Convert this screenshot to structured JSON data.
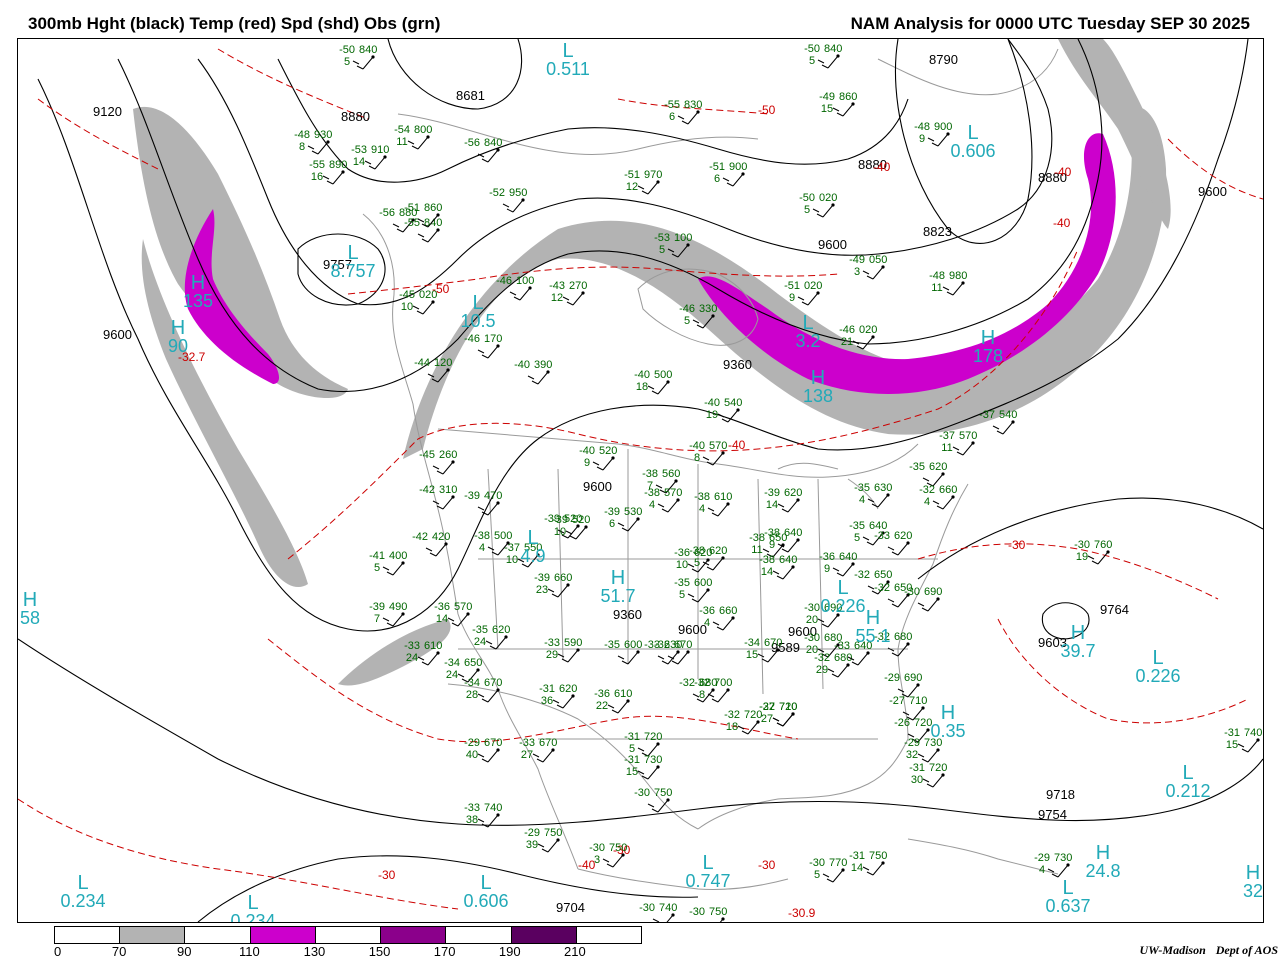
{
  "title_left": "300mb Hght (black) Temp (red) Spd (shd) Obs (grn)",
  "title_right": "NAM Analysis for 0000 UTC Tuesday  SEP 30 2025",
  "credit": {
    "org": "UW-Madison",
    "dept": "Dept of AOS"
  },
  "colors": {
    "gray_shade": "#b3b3b3",
    "magenta_shade": "#cc00cc",
    "height": "#000000",
    "temp": "#cc0000",
    "obs": "#006600",
    "centers": "#22aab8",
    "borders": "#9a9a9a"
  },
  "legend": {
    "labels": [
      "0",
      "70",
      "90",
      "110",
      "130",
      "150",
      "170",
      "190",
      "210"
    ],
    "segments": [
      "#ffffff",
      "#b3b3b3",
      "#ffffff",
      "#cc00cc",
      "#ffffff",
      "#8b008b",
      "#ffffff",
      "#5a0060",
      "#ffffff"
    ]
  },
  "height_labels": [
    "9120",
    "8880",
    "8681",
    "8790",
    "8880",
    "8823",
    "9600",
    "9600",
    "9360",
    "9600",
    "9360",
    "9600",
    "9589",
    "9764",
    "9603",
    "9718",
    "9754",
    "9704",
    "9757",
    "9600",
    "9600",
    "8880"
  ],
  "temp_labels": [
    "-50",
    "-50",
    "-40",
    "-40",
    "-40",
    "-40",
    "-40",
    "-30",
    "-30",
    "-30",
    "-30",
    "-32.7",
    "-30.9"
  ],
  "centers": [
    {
      "sym": "L",
      "val": "0.511"
    },
    {
      "sym": "L",
      "val": "0.606"
    },
    {
      "sym": "L",
      "val": "8.757"
    },
    {
      "sym": "H",
      "val": "135"
    },
    {
      "sym": "H",
      "val": "90"
    },
    {
      "sym": "L",
      "val": "10.5"
    },
    {
      "sym": "L",
      "val": "3.2"
    },
    {
      "sym": "H",
      "val": "138"
    },
    {
      "sym": "H",
      "val": "178"
    },
    {
      "sym": "H",
      "val": "51.7"
    },
    {
      "sym": "L",
      "val": "4.9"
    },
    {
      "sym": "L",
      "val": "0.226"
    },
    {
      "sym": "H",
      "val": "55.1"
    },
    {
      "sym": "L",
      "val": "0.226"
    },
    {
      "sym": "H",
      "val": "39.7"
    },
    {
      "sym": "H",
      "val": "0.35"
    },
    {
      "sym": "L",
      "val": "0.212"
    },
    {
      "sym": "H",
      "val": "24.8"
    },
    {
      "sym": "L",
      "val": "0.637"
    },
    {
      "sym": "L",
      "val": "0.234"
    },
    {
      "sym": "L",
      "val": "0.234"
    },
    {
      "sym": "L",
      "val": "0.606"
    },
    {
      "sym": "L",
      "val": "0.747"
    },
    {
      "sym": "H",
      "val": "32"
    },
    {
      "sym": "H",
      "val": "58"
    }
  ],
  "obs": [
    [
      "-50",
      "840",
      "5"
    ],
    [
      "-48",
      "930",
      "8"
    ],
    [
      "-54",
      "800",
      "11"
    ],
    [
      "-53",
      "910",
      "14"
    ],
    [
      "-55",
      "890",
      "16"
    ],
    [
      "-56",
      "880",
      ""
    ],
    [
      "-55",
      "840",
      ""
    ],
    [
      "-51",
      "860",
      ""
    ],
    [
      "-52",
      "950",
      ""
    ],
    [
      "-56",
      "840",
      ""
    ],
    [
      "-51",
      "970",
      "12"
    ],
    [
      "-55",
      "830",
      "6"
    ],
    [
      "-51",
      "900",
      "6"
    ],
    [
      "-50",
      "840",
      "5"
    ],
    [
      "-49",
      "860",
      "15"
    ],
    [
      "-48",
      "900",
      "9"
    ],
    [
      "-50",
      "020",
      "5"
    ],
    [
      "-49",
      "050",
      "3"
    ],
    [
      "-48",
      "980",
      "11"
    ],
    [
      "-51",
      "020",
      "9"
    ],
    [
      "-46",
      "020",
      "21"
    ],
    [
      "-53",
      "100",
      "5"
    ],
    [
      "-46",
      "330",
      "5"
    ],
    [
      "-43",
      "270",
      "12"
    ],
    [
      "-46",
      "100",
      ""
    ],
    [
      "-45",
      "020",
      "10"
    ],
    [
      "-46",
      "170",
      ""
    ],
    [
      "-44",
      "120",
      ""
    ],
    [
      "-40",
      "390",
      ""
    ],
    [
      "-40",
      "500",
      "18"
    ],
    [
      "-40",
      "540",
      "19"
    ],
    [
      "-40",
      "570",
      "8"
    ],
    [
      "-40",
      "520",
      "9"
    ],
    [
      "-38",
      "560",
      "7"
    ],
    [
      "-38",
      "570",
      "4"
    ],
    [
      "-38",
      "610",
      "4"
    ],
    [
      "-39",
      "620",
      "14"
    ],
    [
      "-38",
      "620",
      "5"
    ],
    [
      "-38",
      "640",
      "9"
    ],
    [
      "-37",
      "570",
      "11"
    ],
    [
      "-37",
      "540",
      ""
    ],
    [
      "-39",
      "520",
      ""
    ],
    [
      "-35",
      "620",
      ""
    ],
    [
      "-35",
      "630",
      "4"
    ],
    [
      "-32",
      "660",
      "4"
    ],
    [
      "-45",
      "260",
      ""
    ],
    [
      "-42",
      "310",
      ""
    ],
    [
      "-39",
      "470",
      ""
    ],
    [
      "-39",
      "530",
      "6"
    ],
    [
      "-39",
      "520",
      "10"
    ],
    [
      "-38",
      "500",
      "4"
    ],
    [
      "-37",
      "550",
      "10"
    ],
    [
      "-42",
      "420",
      ""
    ],
    [
      "-41",
      "400",
      "5"
    ],
    [
      "-39",
      "660",
      "23"
    ],
    [
      "-36",
      "620",
      "10"
    ],
    [
      "-38",
      "650",
      "11"
    ],
    [
      "-38",
      "640",
      "14"
    ],
    [
      "-35",
      "640",
      "5"
    ],
    [
      "-33",
      "620",
      ""
    ],
    [
      "-36",
      "640",
      "9"
    ],
    [
      "-32",
      "650",
      ""
    ],
    [
      "-35",
      "600",
      "5"
    ],
    [
      "-36",
      "660",
      "4"
    ],
    [
      "-32",
      "650",
      ""
    ],
    [
      "-30",
      "690",
      ""
    ],
    [
      "-39",
      "490",
      "7"
    ],
    [
      "-36",
      "570",
      "14"
    ],
    [
      "-35",
      "620",
      "24"
    ],
    [
      "-33",
      "610",
      "24"
    ],
    [
      "-34",
      "650",
      "24"
    ],
    [
      "-34",
      "670",
      "28"
    ],
    [
      "-33",
      "590",
      "29"
    ],
    [
      "-35",
      "600",
      ""
    ],
    [
      "-33",
      "630",
      ""
    ],
    [
      "-32",
      "670",
      ""
    ],
    [
      "-34",
      "670",
      "15"
    ],
    [
      "-30",
      "690",
      "20"
    ],
    [
      "-30",
      "680",
      "20"
    ],
    [
      "-32",
      "680",
      "29"
    ],
    [
      "-33",
      "640",
      ""
    ],
    [
      "-32",
      "680",
      ""
    ],
    [
      "-29",
      "690",
      ""
    ],
    [
      "-31",
      "620",
      "36"
    ],
    [
      "-36",
      "610",
      "22"
    ],
    [
      "-32",
      "680",
      ""
    ],
    [
      "-32",
      "700",
      "8"
    ],
    [
      "-32",
      "720",
      "18"
    ],
    [
      "-32",
      "720",
      ""
    ],
    [
      "-27",
      "710",
      "27"
    ],
    [
      "-27",
      "710",
      ""
    ],
    [
      "-26",
      "720",
      ""
    ],
    [
      "-29",
      "730",
      "32"
    ],
    [
      "-31",
      "720",
      "30"
    ],
    [
      "-29",
      "670",
      "40"
    ],
    [
      "-33",
      "670",
      "27"
    ],
    [
      "-31",
      "720",
      "5"
    ],
    [
      "-31",
      "730",
      "15"
    ],
    [
      "-30",
      "750",
      ""
    ],
    [
      "-33",
      "740",
      "38"
    ],
    [
      "-29",
      "750",
      "39"
    ],
    [
      "-30",
      "750",
      "3"
    ],
    [
      "-30",
      "770",
      "5"
    ],
    [
      "-31",
      "750",
      "14"
    ],
    [
      "-30",
      "740",
      ""
    ],
    [
      "-30",
      "750",
      ""
    ],
    [
      "-29",
      "730",
      "4"
    ],
    [
      "-31",
      "740",
      "15"
    ],
    [
      "-30",
      "760",
      "19"
    ]
  ]
}
